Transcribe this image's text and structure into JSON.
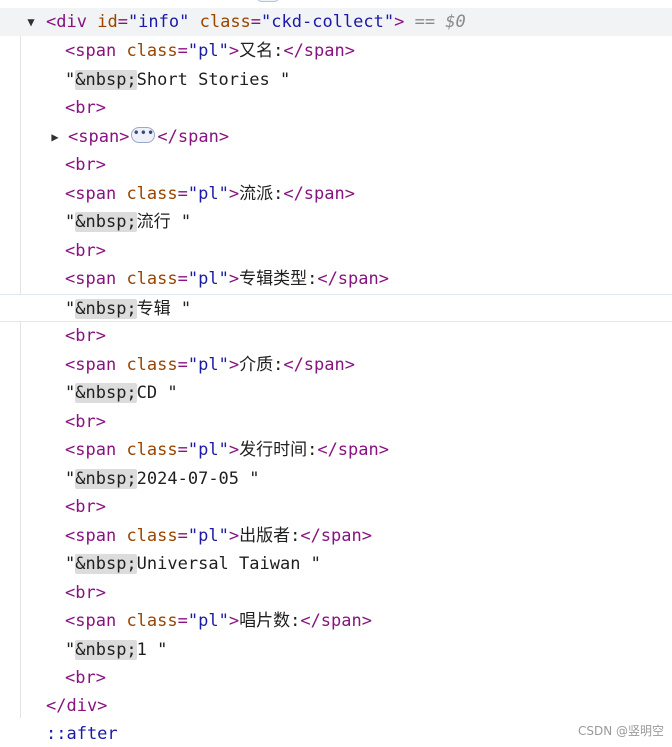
{
  "elements_tree": {
    "root": {
      "tag_open": "<div",
      "id_attr": "id",
      "id_value": "\"info\"",
      "class_attr": "class",
      "class_value": "\"ckd-collect\"",
      "tag_close_bracket": ">",
      "selected_marker": "== $0",
      "close_tag": "</div>"
    },
    "children": [
      {
        "kind": "span",
        "label": "又名:"
      },
      {
        "kind": "text",
        "entity": "&nbsp;",
        "value": "Short Stories"
      },
      {
        "kind": "br"
      },
      {
        "kind": "collapsed-span"
      },
      {
        "kind": "br"
      },
      {
        "kind": "span",
        "label": "流派:"
      },
      {
        "kind": "text",
        "entity": "&nbsp;",
        "value": "流行"
      },
      {
        "kind": "br"
      },
      {
        "kind": "span",
        "label": "专辑类型:"
      },
      {
        "kind": "text",
        "entity": "&nbsp;",
        "value": "专辑"
      },
      {
        "kind": "br"
      },
      {
        "kind": "span",
        "label": "介质:"
      },
      {
        "kind": "text",
        "entity": "&nbsp;",
        "value": "CD"
      },
      {
        "kind": "br"
      },
      {
        "kind": "span",
        "label": "发行时间:"
      },
      {
        "kind": "text",
        "entity": "&nbsp;",
        "value": "2024-07-05"
      },
      {
        "kind": "br"
      },
      {
        "kind": "span",
        "label": "出版者:"
      },
      {
        "kind": "text",
        "entity": "&nbsp;",
        "value": "Universal Taiwan"
      },
      {
        "kind": "br"
      },
      {
        "kind": "span",
        "label": "唱片数:"
      },
      {
        "kind": "text",
        "entity": "&nbsp;",
        "value": "1"
      },
      {
        "kind": "br"
      }
    ],
    "span_markup": {
      "open": "<span",
      "class_attr": "class",
      "class_value": "\"pl\"",
      "gt": ">",
      "close": "</span>",
      "bare_open": "<span>",
      "ellipsis": "•••"
    },
    "br_markup": "<br>",
    "pseudo_after": "::after"
  },
  "watermark": "CSDN @竖明空",
  "colors": {
    "tag": "#881280",
    "attribute_name": "#994500",
    "attribute_value": "#1a1aa6",
    "text": "#1f1f1f",
    "entity_highlight": "#dcdcdc",
    "selected_row": "#f1f3f4"
  },
  "icons": {
    "expanded": "triangle-down-icon",
    "collapsed": "triangle-right-icon"
  }
}
